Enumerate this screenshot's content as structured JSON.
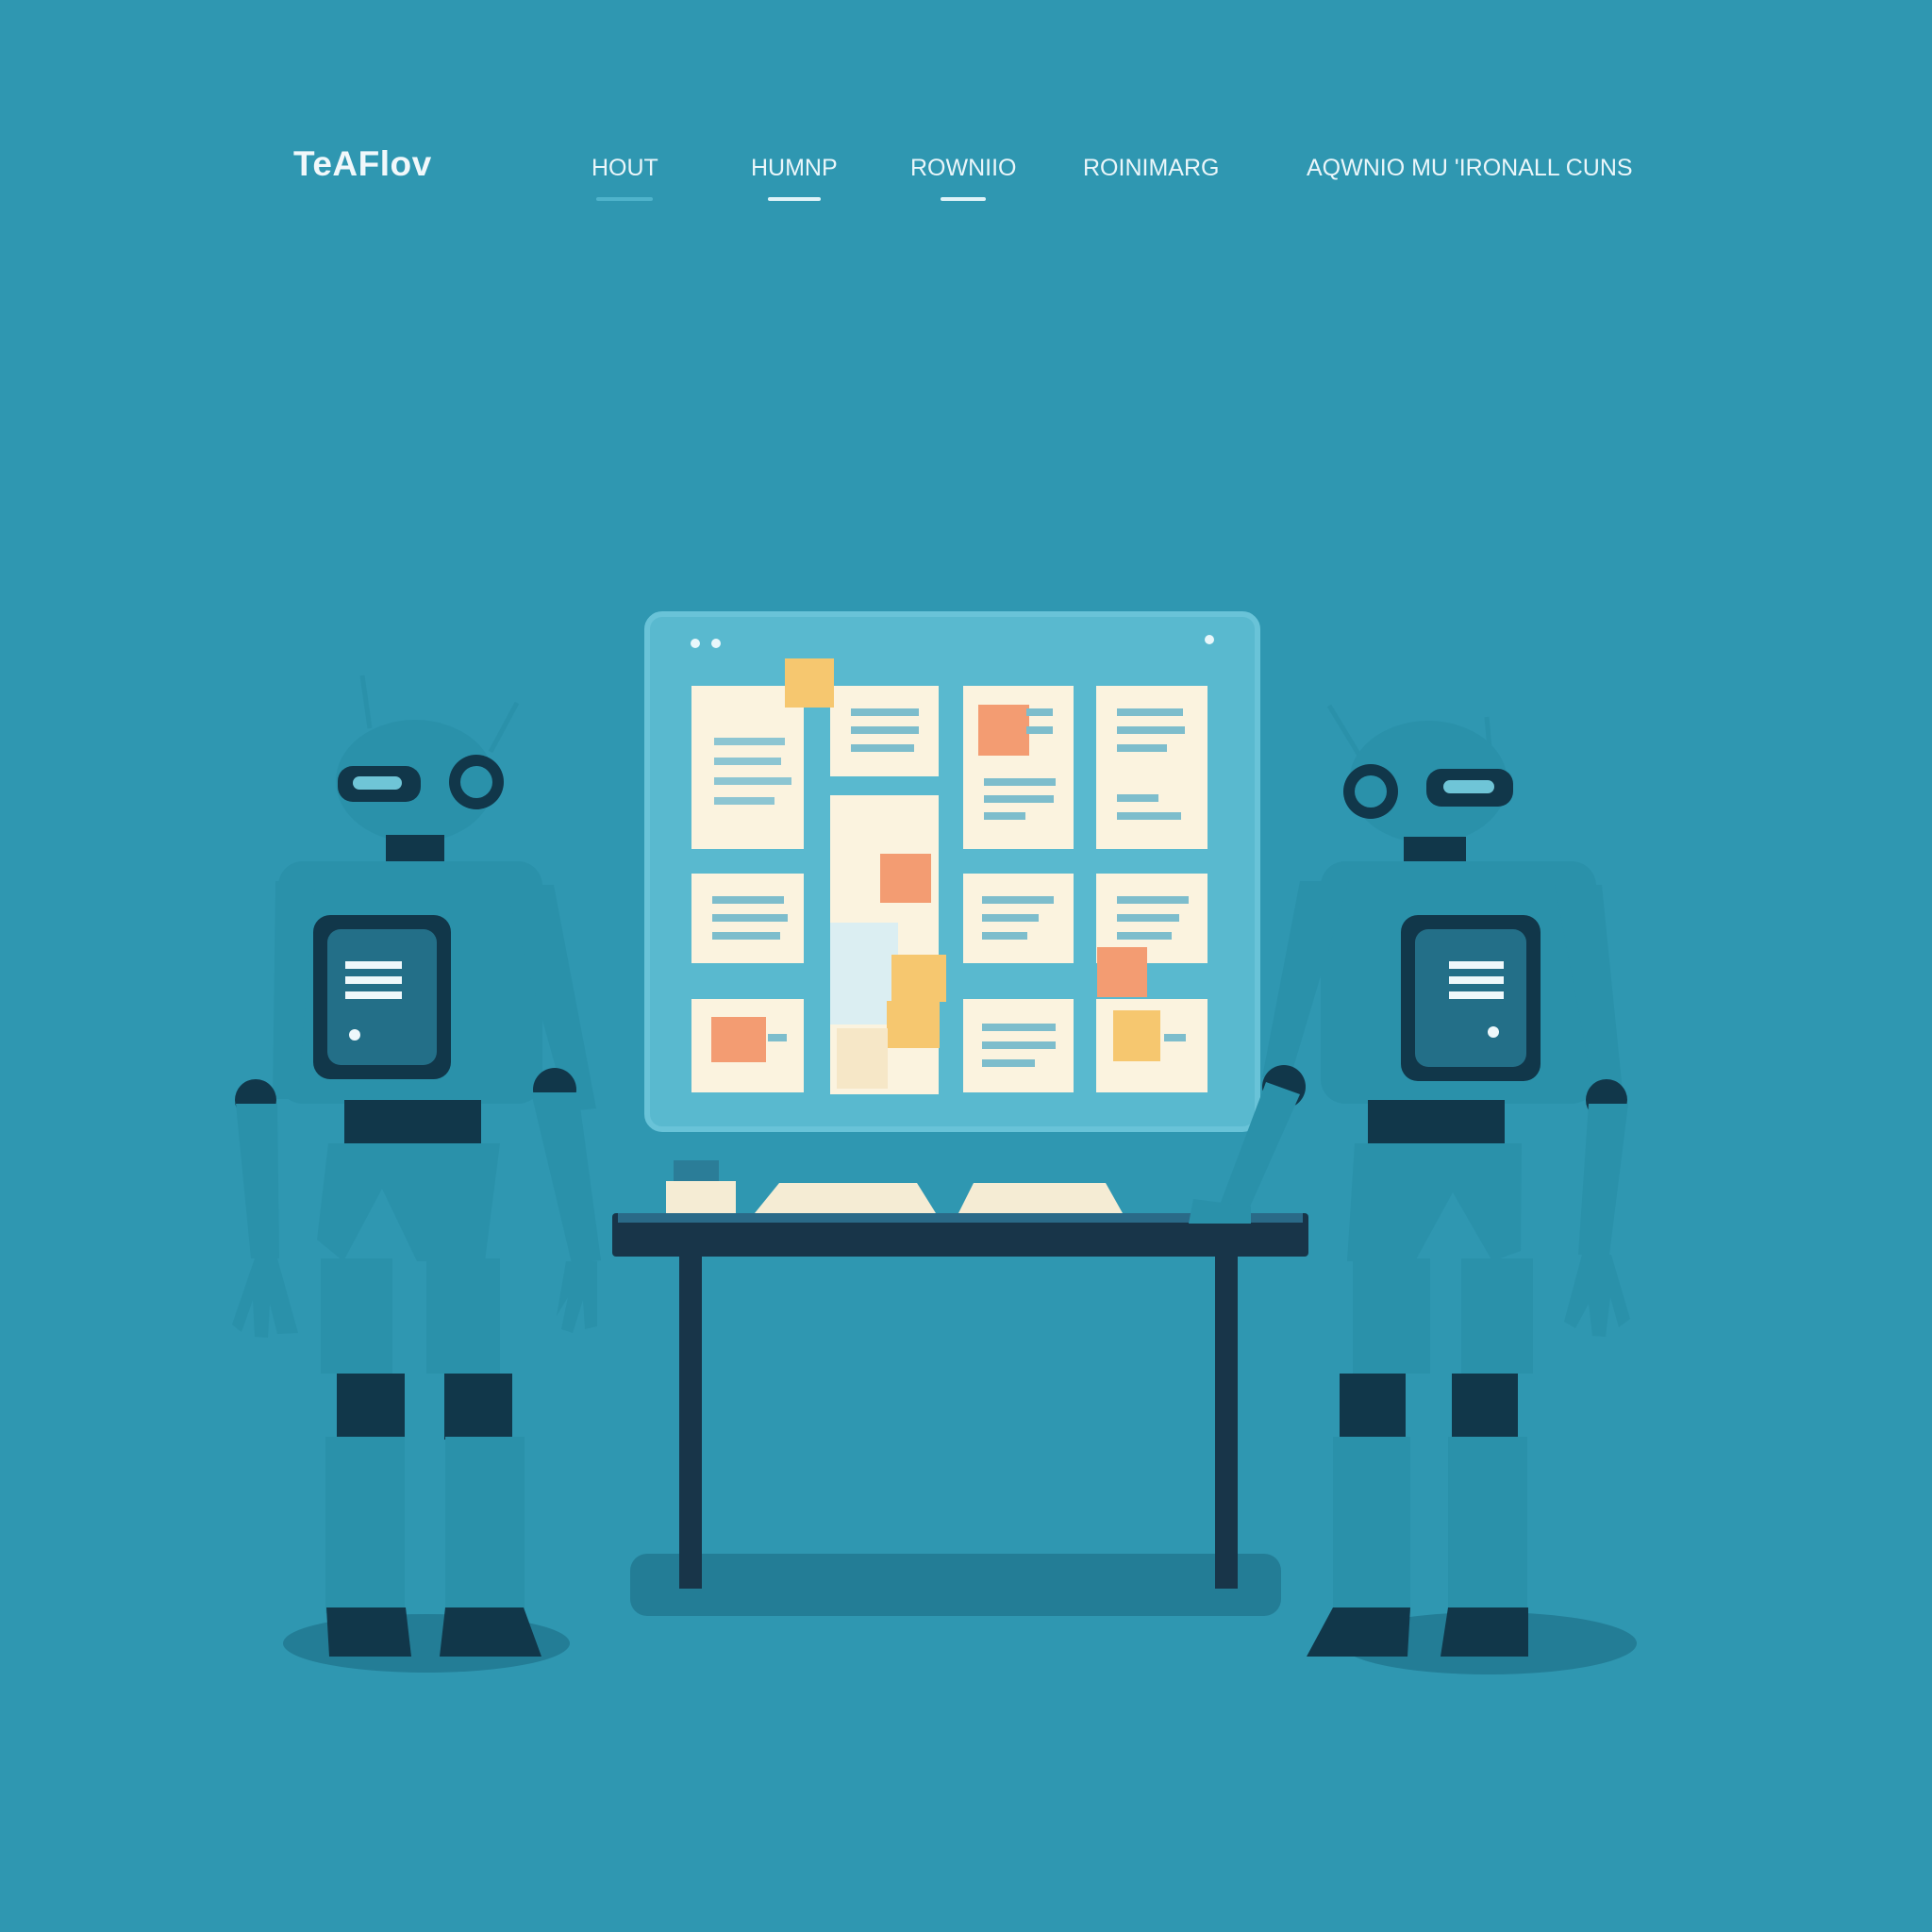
{
  "brand": {
    "name": "TeAFlov"
  },
  "nav": {
    "items": [
      {
        "label": "HOUT"
      },
      {
        "label": "HUMNP"
      },
      {
        "label": "ROWNIIO"
      },
      {
        "label": "ROINIMARG"
      },
      {
        "label": "AQWNIO MU 'IRONALL CUNS"
      }
    ]
  },
  "colors": {
    "background": "#2f97b1",
    "board": "#59b9cf",
    "card": "#fbf3df",
    "sticky_orange": "#f39c72",
    "sticky_yellow": "#f6c76f",
    "robot_body": "#2a91aa",
    "robot_dark": "#11374a",
    "table_top": "#183549"
  },
  "illustration": {
    "icons": [
      "board-icon",
      "robot-left-icon",
      "robot-right-icon",
      "table-icon"
    ]
  }
}
